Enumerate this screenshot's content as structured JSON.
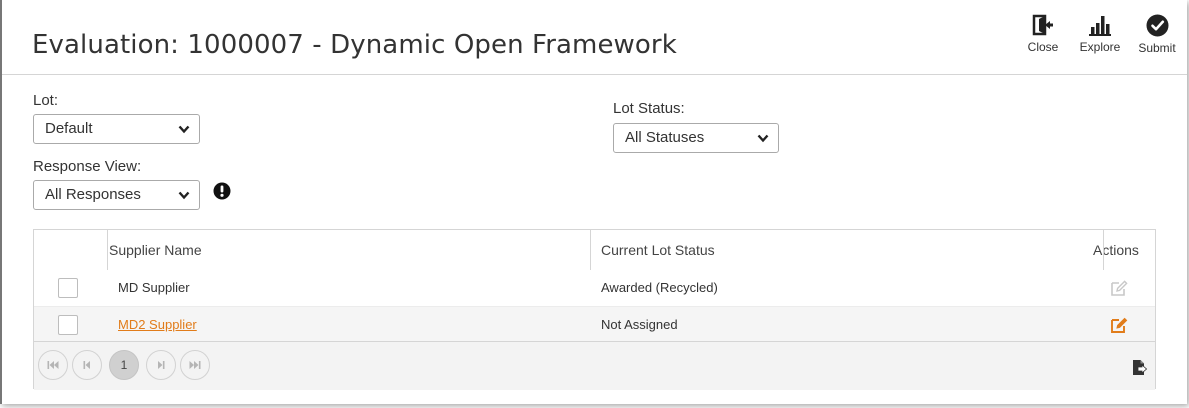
{
  "header": {
    "title": "Evaluation: 1000007 - Dynamic Open Framework",
    "buttons": [
      {
        "label": "Close",
        "icon": "door-exit-icon"
      },
      {
        "label": "Explore",
        "icon": "bar-chart-icon"
      },
      {
        "label": "Submit",
        "icon": "check-circle-icon"
      }
    ]
  },
  "filters": {
    "lot": {
      "label": "Lot:",
      "value": "Default"
    },
    "response_view": {
      "label": "Response View:",
      "value": "All Responses"
    },
    "lot_status": {
      "label": "Lot Status:",
      "value": "All Statuses"
    }
  },
  "grid": {
    "columns": [
      "",
      "Supplier Name",
      "Current Lot Status",
      "Actions"
    ],
    "rows": [
      {
        "supplier": "MD Supplier",
        "status": "Awarded (Recycled)",
        "editable": false
      },
      {
        "supplier": "MD2 Supplier",
        "status": "Not Assigned",
        "editable": true
      }
    ],
    "pager": {
      "current_page": "1"
    }
  },
  "colors": {
    "accent": "#e17c1a",
    "disabled": "#c8c8c8"
  }
}
